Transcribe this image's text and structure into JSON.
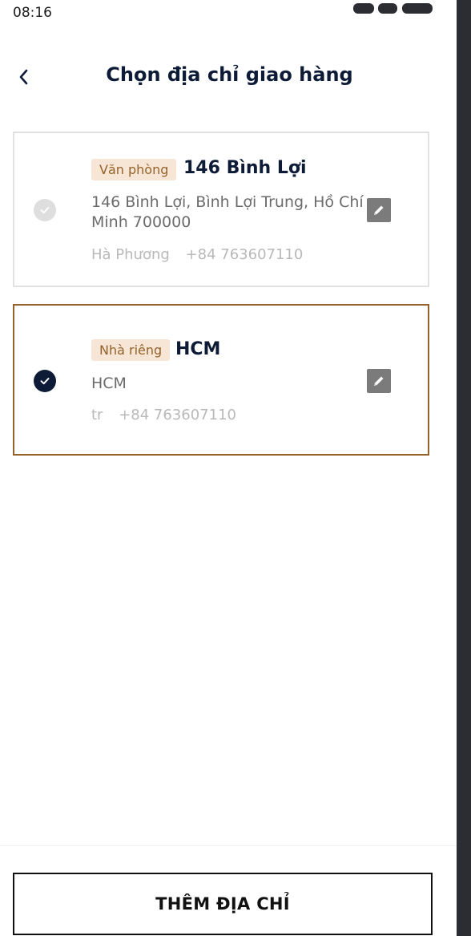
{
  "status_bar": {
    "time": "08:16"
  },
  "header": {
    "title": "Chọn địa chỉ giao hàng",
    "back_icon": "chevron-left-icon"
  },
  "addresses": [
    {
      "tag": "Văn phòng",
      "name": "146 Bình Lợi",
      "address": "146 Bình Lợi, Bình Lợi Trung, Hồ Chí Minh 700000",
      "recipient": "Hà Phương",
      "phone": "+84 763607110",
      "selected": false
    },
    {
      "tag": "Nhà riêng",
      "name": "HCM",
      "address": "HCM",
      "recipient": "tr",
      "phone": "+84 763607110",
      "selected": true
    }
  ],
  "footer": {
    "add_button": "THÊM ĐỊA CHỈ"
  },
  "colors": {
    "primary": "#0d1b36",
    "accent": "#94622a",
    "tag_bg": "#f7e6d6",
    "muted_text": "#6b6b6b",
    "light_text": "#b9b9b9"
  }
}
